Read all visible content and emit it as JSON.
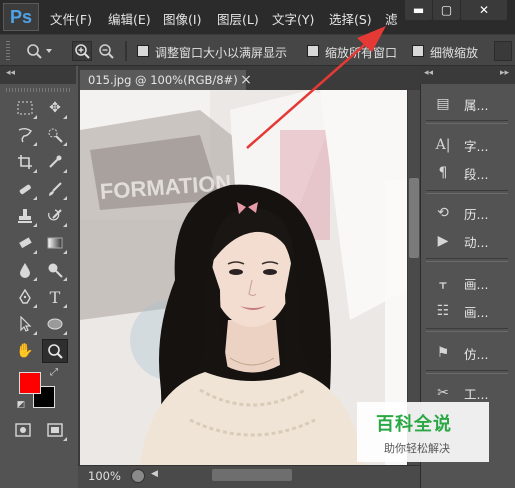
{
  "app": {
    "logo": "Ps",
    "menu": [
      "文件(F)",
      "编辑(E)",
      "图像(I)",
      "图层(L)",
      "文字(Y)",
      "选择(S)",
      "滤"
    ],
    "window_controls": {
      "minimize": "▬",
      "restore": "▢",
      "close": "✕"
    }
  },
  "options_bar": {
    "tool_icon": "zoom-icon",
    "checkboxes": [
      {
        "label": "调整窗口大小以满屏显示",
        "checked": false
      },
      {
        "label": "缩放所有窗口",
        "checked": false
      },
      {
        "label": "细微缩放",
        "checked": false
      }
    ]
  },
  "document": {
    "tab_title": "015.jpg @ 100%(RGB/8#)",
    "close": "×",
    "zoom": "100%"
  },
  "colors": {
    "foreground": "#ff0000",
    "background": "#000000",
    "arrow": "#e53935",
    "watermark_green": "#2aa845"
  },
  "tools": [
    "marquee-icon",
    "move-icon",
    "lasso-icon",
    "quick-select-icon",
    "crop-icon",
    "eyedropper-icon",
    "healing-icon",
    "brush-icon",
    "stamp-icon",
    "history-brush-icon",
    "eraser-icon",
    "gradient-icon",
    "blur-icon",
    "dodge-icon",
    "pen-icon",
    "type-icon",
    "path-select-icon",
    "ellipse-icon",
    "hand-icon",
    "zoom-icon"
  ],
  "right_panels": [
    {
      "icon": "properties-icon",
      "label": "属..."
    },
    {
      "icon": "character-icon",
      "label": "字..."
    },
    {
      "icon": "paragraph-icon",
      "label": "段..."
    },
    {
      "icon": "history-icon",
      "label": "历..."
    },
    {
      "icon": "actions-icon",
      "label": "动..."
    },
    {
      "icon": "brush-presets-icon",
      "label": "画..."
    },
    {
      "icon": "brush-panel-icon",
      "label": "画..."
    },
    {
      "icon": "clone-source-icon",
      "label": "仿..."
    },
    {
      "icon": "tool-presets-icon",
      "label": "工..."
    }
  ],
  "watermark": {
    "title": "百科全说",
    "subtitle": "助你轻松解决"
  },
  "photo": {
    "background_text": "FORMATION"
  }
}
